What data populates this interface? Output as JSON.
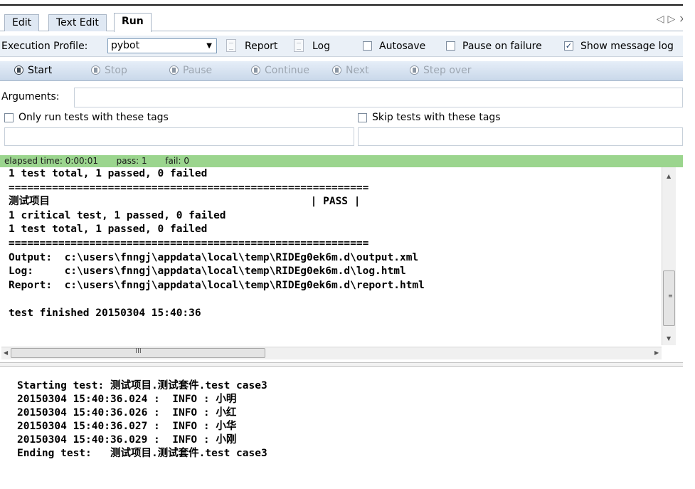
{
  "tabs": [
    {
      "label": "Edit"
    },
    {
      "label": "Text Edit"
    },
    {
      "label": "Run"
    }
  ],
  "tab_nav": {
    "prev": "◁",
    "next": "▷",
    "close": "×"
  },
  "profile_bar": {
    "execution_profile_label": "Execution Profile:",
    "execution_profile_value": "pybot",
    "report_label": "Report",
    "log_label": "Log",
    "autosave_label": "Autosave",
    "autosave_checked": false,
    "pause_on_failure_label": "Pause on failure",
    "pause_on_failure_checked": false,
    "show_message_log_label": "Show message log",
    "show_message_log_checked": true
  },
  "toolbar": {
    "start": "Start",
    "stop": "Stop",
    "pause": "Pause",
    "continue": "Continue",
    "next": "Next",
    "step_over": "Step over"
  },
  "arguments": {
    "label": "Arguments:",
    "value": ""
  },
  "tags": {
    "only_run_label": "Only run tests with these tags",
    "only_run_value": "",
    "skip_label": "Skip tests with these tags",
    "skip_value": ""
  },
  "status": {
    "elapsed": "elapsed time: 0:00:01",
    "pass": "pass: 1",
    "fail": "fail: 0",
    "color": "#9bd58e"
  },
  "output_lines": [
    "1 test total, 1 passed, 0 failed",
    "==========================================================",
    "测试项目                                          | PASS |",
    "1 critical test, 1 passed, 0 failed",
    "1 test total, 1 passed, 0 failed",
    "==========================================================",
    "Output:  c:\\users\\fnngj\\appdata\\local\\temp\\RIDEg0ek6m.d\\output.xml",
    "Log:     c:\\users\\fnngj\\appdata\\local\\temp\\RIDEg0ek6m.d\\log.html",
    "Report:  c:\\users\\fnngj\\appdata\\local\\temp\\RIDEg0ek6m.d\\report.html",
    "",
    "test finished 20150304 15:40:36"
  ],
  "message_log_lines": [
    "Starting test: 测试项目.测试套件.test case3",
    "20150304 15:40:36.024 :  INFO : 小明",
    "20150304 15:40:36.026 :  INFO : 小红",
    "20150304 15:40:36.027 :  INFO : 小华",
    "20150304 15:40:36.029 :  INFO : 小刚",
    "Ending test:   测试项目.测试套件.test case3"
  ]
}
